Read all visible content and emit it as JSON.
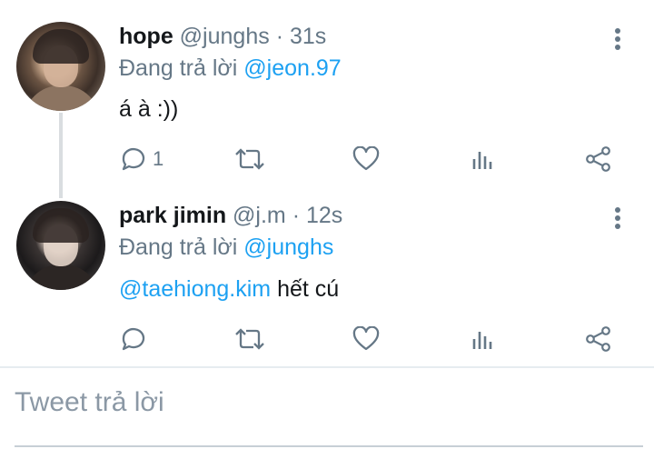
{
  "tweets": [
    {
      "name": "hope",
      "handle": "@junghs",
      "separator": "·",
      "time": "31s",
      "reply_prefix": "Đang trả lời",
      "reply_to": "@jeon.97",
      "text": "á à :))",
      "mention_in_text": "",
      "reply_count": "1"
    },
    {
      "name": "park jimin",
      "handle": "@j.m",
      "separator": "·",
      "time": "12s",
      "reply_prefix": "Đang trả lời",
      "reply_to": "@junghs",
      "mention_in_text": "@taehiong.kim",
      "text": "hết cú",
      "reply_count": ""
    }
  ],
  "composer": {
    "placeholder": "Tweet trả lời"
  },
  "icons": [
    "reply-icon",
    "retweet-icon",
    "like-icon",
    "analytics-icon",
    "share-icon",
    "more-icon"
  ],
  "colors": {
    "accent": "#1da1f2",
    "secondary_text": "#657786",
    "icon": "#657786"
  }
}
